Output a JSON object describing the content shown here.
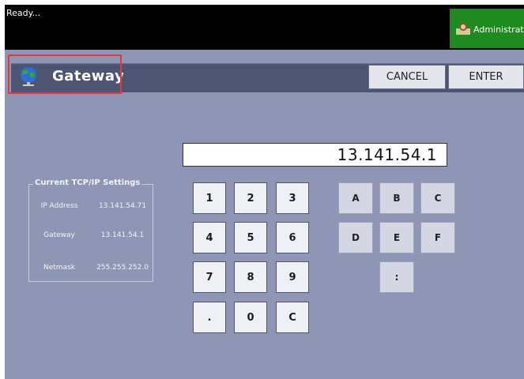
{
  "status_text": "Ready...",
  "admin_label": "Administrat",
  "header": {
    "title": "Gateway"
  },
  "buttons": {
    "cancel": "CANCEL",
    "enter": "ENTER"
  },
  "ip_entry": {
    "value": "13.141.54.1"
  },
  "current_settings": {
    "title": "Current TCP/IP Settings",
    "rows": [
      {
        "label": "IP Address",
        "value": "13.141.54.71"
      },
      {
        "label": "Gateway",
        "value": "13.141.54.1"
      },
      {
        "label": "Netmask",
        "value": "255.255.252.0"
      }
    ]
  },
  "keypad": {
    "keys": [
      "1",
      "2",
      "3",
      "4",
      "5",
      "6",
      "7",
      "8",
      "9",
      ".",
      "0",
      "C"
    ],
    "hex": [
      "A",
      "B",
      "C",
      "D",
      "E",
      "F",
      ":"
    ]
  },
  "colors": {
    "accent_green": "#1f8a1f",
    "panel": "#8f96b5",
    "header": "#4e5572",
    "highlight": "#e23a3a"
  }
}
